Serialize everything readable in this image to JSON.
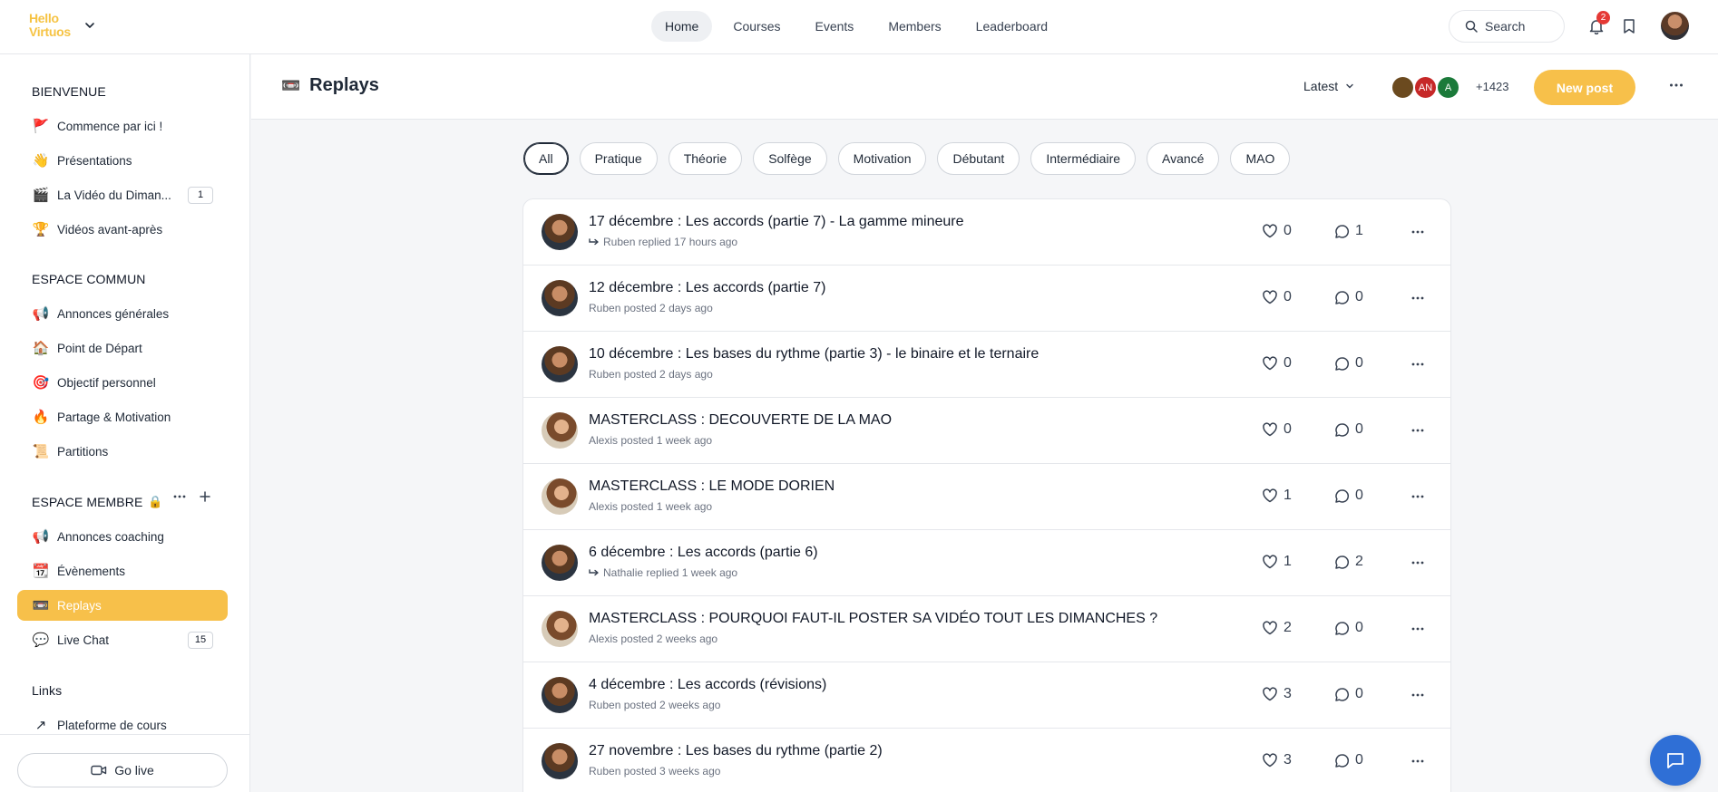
{
  "brand": {
    "line1": "Hello",
    "line2": "Virtuos"
  },
  "topnav": [
    {
      "label": "Home",
      "active": true
    },
    {
      "label": "Courses"
    },
    {
      "label": "Events"
    },
    {
      "label": "Members"
    },
    {
      "label": "Leaderboard"
    }
  ],
  "search": {
    "label": "Search"
  },
  "notifications": {
    "count": "2"
  },
  "sidebar": {
    "sections": [
      {
        "title": "BIENVENUE",
        "items": [
          {
            "emoji": "🚩",
            "label": "Commence par ici !"
          },
          {
            "emoji": "👋",
            "label": "Présentations"
          },
          {
            "emoji": "🎬",
            "label": "La Vidéo du Diman...",
            "badge": "1"
          },
          {
            "emoji": "🏆",
            "label": "Vidéos avant-après"
          }
        ]
      },
      {
        "title": "ESPACE COMMUN",
        "items": [
          {
            "emoji": "📢",
            "label": "Annonces générales"
          },
          {
            "emoji": "🏠",
            "label": "Point de Départ"
          },
          {
            "emoji": "🎯",
            "label": "Objectif personnel"
          },
          {
            "emoji": "🔥",
            "label": "Partage & Motivation"
          },
          {
            "emoji": "📜",
            "label": "Partitions"
          }
        ]
      },
      {
        "title": "ESPACE MEMBRE",
        "title_emoji": "🔒",
        "items": [
          {
            "emoji": "📢",
            "label": "Annonces coaching"
          },
          {
            "emoji": "📆",
            "label": "Évènements"
          },
          {
            "emoji": "📼",
            "label": "Replays",
            "active": true
          },
          {
            "emoji": "💬",
            "label": "Live Chat",
            "badge": "15"
          }
        ]
      },
      {
        "title": "Links",
        "items": [
          {
            "emoji": "↗",
            "label": "Plateforme de cours"
          }
        ]
      }
    ],
    "go_live": "Go live"
  },
  "page": {
    "emoji": "📼",
    "title": "Replays",
    "sort_label": "Latest",
    "member_avatars": [
      {
        "initials": "",
        "color": "#6b4a1f"
      },
      {
        "initials": "AN",
        "color": "#c62828"
      },
      {
        "initials": "A",
        "color": "#1b7a3a"
      }
    ],
    "member_count": "+1423",
    "new_post": "New post"
  },
  "filters": [
    "All",
    "Pratique",
    "Théorie",
    "Solfège",
    "Motivation",
    "Débutant",
    "Intermédiaire",
    "Avancé",
    "MAO"
  ],
  "posts": [
    {
      "title": "17 décembre : Les accords (partie 7) - La gamme mineure",
      "meta": "Ruben replied 17 hours ago",
      "reply": true,
      "author": "ruben",
      "likes": "0",
      "comments": "1"
    },
    {
      "title": "12 décembre : Les accords (partie 7)",
      "meta": "Ruben posted 2 days ago",
      "reply": false,
      "author": "ruben",
      "likes": "0",
      "comments": "0"
    },
    {
      "title": "10 décembre : Les bases du rythme (partie 3) - le binaire et le ternaire",
      "meta": "Ruben posted 2 days ago",
      "reply": false,
      "author": "ruben",
      "likes": "0",
      "comments": "0"
    },
    {
      "title": "MASTERCLASS : DECOUVERTE DE LA MAO",
      "meta": "Alexis posted 1 week ago",
      "reply": false,
      "author": "alexis",
      "likes": "0",
      "comments": "0"
    },
    {
      "title": "MASTERCLASS : LE MODE DORIEN",
      "meta": "Alexis posted 1 week ago",
      "reply": false,
      "author": "alexis",
      "likes": "1",
      "comments": "0"
    },
    {
      "title": "6 décembre : Les accords (partie 6)",
      "meta": "Nathalie replied 1 week ago",
      "reply": true,
      "author": "ruben",
      "likes": "1",
      "comments": "2"
    },
    {
      "title": "MASTERCLASS : POURQUOI FAUT-IL POSTER SA VIDÉO TOUT LES DIMANCHES ?",
      "meta": "Alexis posted 2 weeks ago",
      "reply": false,
      "author": "alexis",
      "likes": "2",
      "comments": "0"
    },
    {
      "title": "4 décembre : Les accords (révisions)",
      "meta": "Ruben posted 2 weeks ago",
      "reply": false,
      "author": "ruben",
      "likes": "3",
      "comments": "0"
    },
    {
      "title": "27 novembre : Les bases du rythme (partie 2)",
      "meta": "Ruben posted 3 weeks ago",
      "reply": false,
      "author": "ruben",
      "likes": "3",
      "comments": "0"
    }
  ],
  "colors": {
    "accent": "#f7c04a",
    "brand": "#f6c343",
    "chat": "#2f6fd6",
    "badge": "#e53935"
  }
}
